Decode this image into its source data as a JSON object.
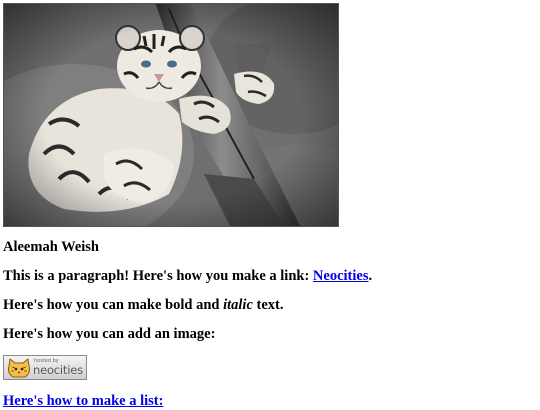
{
  "page": {
    "hero_image_alt": "white tiger cub climbing a tree branch",
    "author": "Aleemah Weish",
    "paragraph": {
      "prefix": "This is a paragraph! Here's how you make a link: ",
      "link_text": "Neocities",
      "suffix": "."
    },
    "bold_italic": {
      "prefix": "Here's how you can make bold and ",
      "italic_word": "italic",
      "suffix": " text."
    },
    "image_intro": "Here's how you can add an image:",
    "badge": {
      "small_text": "hosted by",
      "big_text": "neocities"
    },
    "list_intro": "Here's how to make a list:"
  }
}
